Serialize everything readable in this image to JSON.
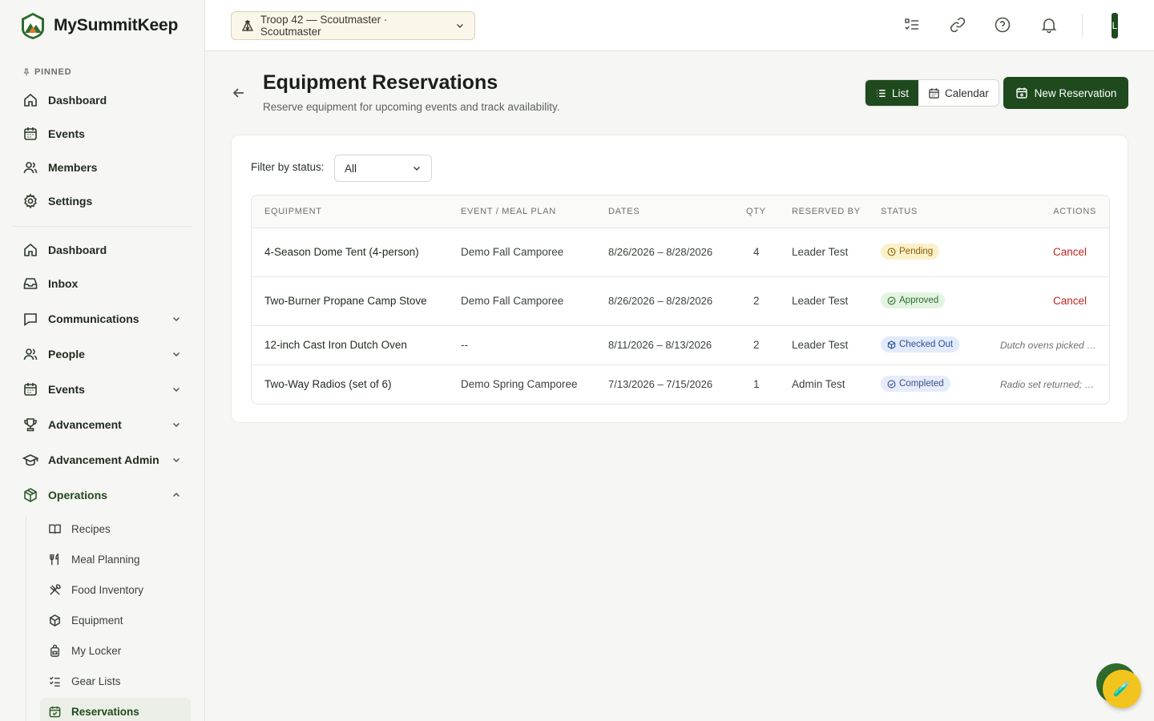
{
  "app": {
    "name": "MySummitKeep"
  },
  "sidebar": {
    "pinned_label": "PINNED",
    "pinned": [
      {
        "label": "Dashboard",
        "icon": "home-icon"
      },
      {
        "label": "Events",
        "icon": "calendar-icon"
      },
      {
        "label": "Members",
        "icon": "users-icon"
      },
      {
        "label": "Settings",
        "icon": "gear-icon"
      }
    ],
    "items": [
      {
        "label": "Dashboard",
        "icon": "home-icon"
      },
      {
        "label": "Inbox",
        "icon": "inbox-icon"
      },
      {
        "label": "Communications",
        "icon": "chat-icon"
      },
      {
        "label": "People",
        "icon": "users-icon"
      },
      {
        "label": "Events",
        "icon": "calendar-icon"
      },
      {
        "label": "Advancement",
        "icon": "trophy-icon"
      },
      {
        "label": "Advancement Admin",
        "icon": "graduation-cap-icon"
      },
      {
        "label": "Operations",
        "icon": "box-icon"
      }
    ],
    "operations_sub": [
      {
        "label": "Recipes",
        "icon": "book-icon"
      },
      {
        "label": "Meal Planning",
        "icon": "utensils-icon"
      },
      {
        "label": "Food Inventory",
        "icon": "cutlery-cross-icon"
      },
      {
        "label": "Equipment",
        "icon": "package-icon"
      },
      {
        "label": "My Locker",
        "icon": "backpack-icon"
      },
      {
        "label": "Gear Lists",
        "icon": "checklist-icon"
      },
      {
        "label": "Reservations",
        "icon": "calendar-check-icon"
      }
    ]
  },
  "topbar": {
    "troop_selector": "Troop 42 — Scoutmaster · Scoutmaster",
    "avatar_initial": "L"
  },
  "page": {
    "title": "Equipment Reservations",
    "subtitle": "Reserve equipment for upcoming events and track availability.",
    "view_list": "List",
    "view_calendar": "Calendar",
    "new_button": "New Reservation"
  },
  "filter": {
    "label": "Filter by status:",
    "value": "All"
  },
  "table": {
    "headers": [
      "EQUIPMENT",
      "EVENT / MEAL PLAN",
      "DATES",
      "QTY",
      "RESERVED BY",
      "STATUS",
      "ACTIONS"
    ],
    "rows": [
      {
        "equipment": "4-Season Dome Tent (4-person)",
        "event": "Demo Fall Camporee",
        "dates": "8/26/2026 – 8/28/2026",
        "qty": "4",
        "reserved_by": "Leader Test",
        "status": "Pending",
        "action": "Cancel",
        "note": ""
      },
      {
        "equipment": "Two-Burner Propane Camp Stove",
        "event": "Demo Fall Camporee",
        "dates": "8/26/2026 – 8/28/2026",
        "qty": "2",
        "reserved_by": "Leader Test",
        "status": "Approved",
        "action": "Cancel",
        "note": ""
      },
      {
        "equipment": "12-inch Cast Iron Dutch Oven",
        "event": "--",
        "dates": "8/11/2026 – 8/13/2026",
        "qty": "2",
        "reserved_by": "Leader Test",
        "status": "Checked Out",
        "action": "",
        "note": "Dutch ovens picked u..."
      },
      {
        "equipment": "Two-Way Radios (set of 6)",
        "event": "Demo Spring Camporee",
        "dates": "7/13/2026 – 7/15/2026",
        "qty": "1",
        "reserved_by": "Admin Test",
        "status": "Completed",
        "action": "",
        "note": "Radio set returned; al..."
      }
    ]
  },
  "colors": {
    "brand": "#1e4a1e",
    "cancel": "#c62424",
    "pending": "#fbf1c9",
    "approved": "#e2f4e2",
    "checked_out": "#e2ebfa",
    "fab": "#f2c51e"
  }
}
